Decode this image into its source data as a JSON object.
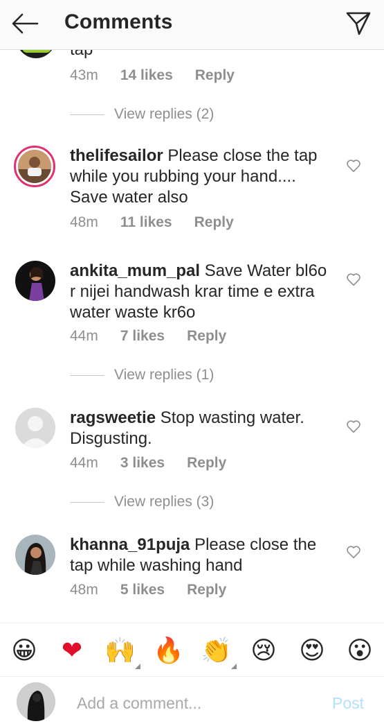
{
  "header": {
    "title": "Comments",
    "back_icon": "back-arrow-icon",
    "send_icon": "direct-send-icon"
  },
  "partial_comment": {
    "text": "tap",
    "time": "43m",
    "likes": "14 likes",
    "reply": "Reply",
    "view_replies": "View replies (2)"
  },
  "comments": [
    {
      "username": "thelifesailor",
      "text": "Please close the tap while you rubbing your hand.... Save water also",
      "time": "48m",
      "likes": "11 likes",
      "reply": "Reply",
      "view_replies": ""
    },
    {
      "username": "ankita_mum_pal",
      "text": "Save Water bl6o r nijei handwash krar time e extra water waste kr6o",
      "time": "44m",
      "likes": "7 likes",
      "reply": "Reply",
      "view_replies": "View replies (1)"
    },
    {
      "username": "ragsweetie",
      "text": "Stop wasting water. Disgusting.",
      "time": "44m",
      "likes": "3 likes",
      "reply": "Reply",
      "view_replies": "View replies (3)"
    },
    {
      "username": "khanna_91puja",
      "text": "Please close the tap while washing hand",
      "time": "48m",
      "likes": "5 likes",
      "reply": "Reply",
      "view_replies": ""
    }
  ],
  "emoji_bar": [
    {
      "name": "grinning-face",
      "glyph": "😀"
    },
    {
      "name": "red-heart",
      "glyph": "❤"
    },
    {
      "name": "raising-hands",
      "glyph": "🙌"
    },
    {
      "name": "fire",
      "glyph": "🔥"
    },
    {
      "name": "clapping-hands",
      "glyph": "👏"
    },
    {
      "name": "crying-face",
      "glyph": "😢"
    },
    {
      "name": "heart-eyes",
      "glyph": "😍"
    },
    {
      "name": "surprised-face",
      "glyph": "😮"
    }
  ],
  "composer": {
    "placeholder": "Add a comment...",
    "post_label": "Post"
  },
  "colors": {
    "text": "#262626",
    "muted": "#8e8e8e",
    "post_disabled": "#b2dffc",
    "heart_outline": "#8e8e8e"
  }
}
